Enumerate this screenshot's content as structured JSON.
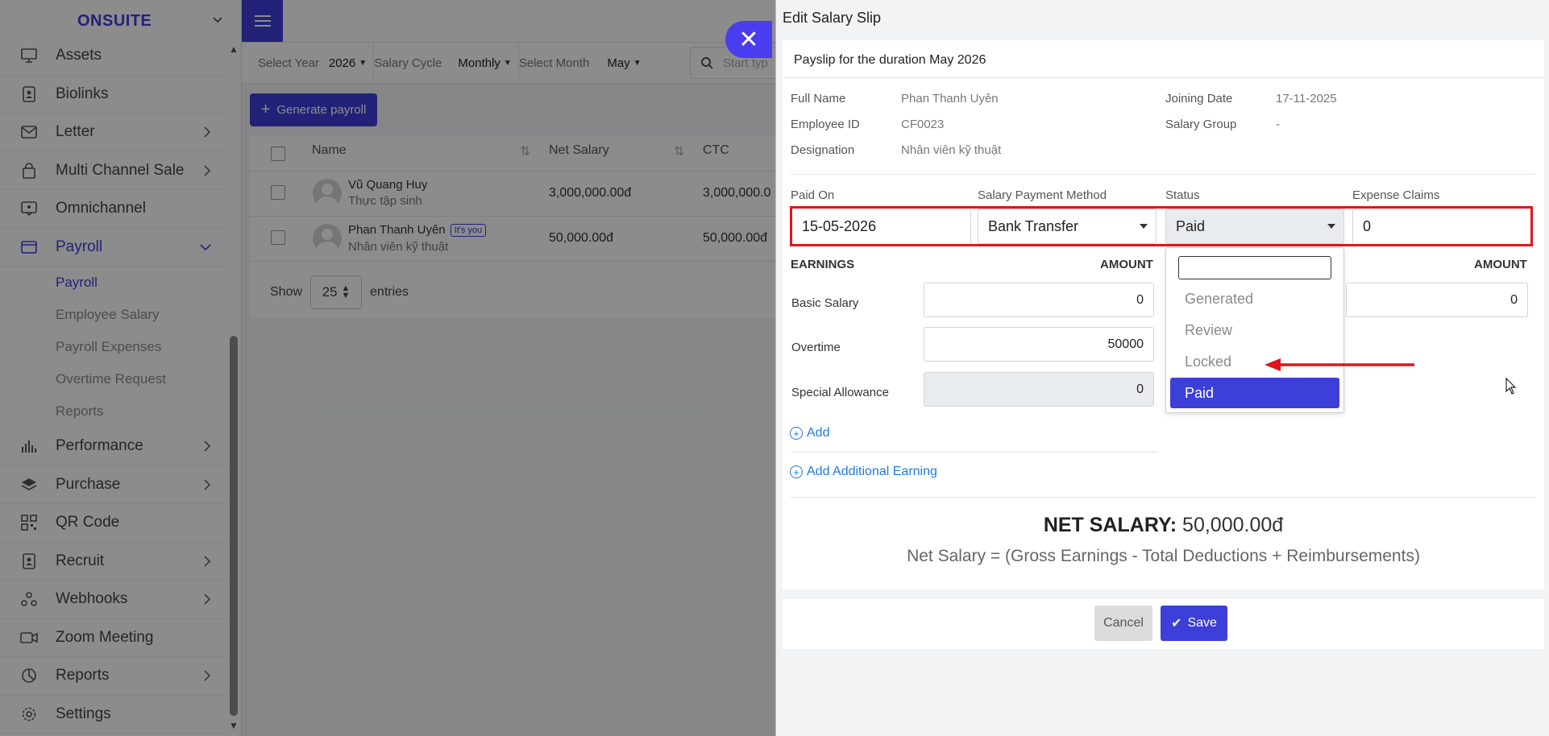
{
  "sidebar": {
    "brand": "ONSUITE",
    "items": [
      {
        "label": "Assets",
        "icon": "monitor-icon",
        "has_arrow": false
      },
      {
        "label": "Biolinks",
        "icon": "id-badge-icon",
        "has_arrow": false
      },
      {
        "label": "Letter",
        "icon": "mail-icon",
        "has_arrow": true
      },
      {
        "label": "Multi Channel Sale",
        "icon": "shopping-bag-icon",
        "has_arrow": true
      },
      {
        "label": "Omnichannel",
        "icon": "chat-icon",
        "has_arrow": false
      },
      {
        "label": "Payroll",
        "icon": "wallet-icon",
        "has_arrow": true,
        "expanded": true
      }
    ],
    "payroll_sub": [
      "Payroll",
      "Employee Salary",
      "Payroll Expenses",
      "Overtime Request",
      "Reports"
    ],
    "items_after": [
      {
        "label": "Performance",
        "icon": "bar-chart-icon",
        "has_arrow": true
      },
      {
        "label": "Purchase",
        "icon": "layers-icon",
        "has_arrow": true
      },
      {
        "label": "QR Code",
        "icon": "qr-code-icon",
        "has_arrow": false
      },
      {
        "label": "Recruit",
        "icon": "id-badge-icon",
        "has_arrow": true
      },
      {
        "label": "Webhooks",
        "icon": "webhook-icon",
        "has_arrow": true
      },
      {
        "label": "Zoom Meeting",
        "icon": "video-icon",
        "has_arrow": false
      },
      {
        "label": "Reports",
        "icon": "pie-chart-icon",
        "has_arrow": true
      },
      {
        "label": "Settings",
        "icon": "gear-icon",
        "has_arrow": false
      }
    ]
  },
  "filters": {
    "year_label": "Select Year",
    "year_value": "2026",
    "cycle_label": "Salary Cycle",
    "cycle_value": "Monthly",
    "month_label": "Select Month",
    "month_value": "May",
    "search_placeholder": "Start typ"
  },
  "generate_button": "Generate payroll",
  "table": {
    "headers": {
      "name": "Name",
      "net_salary": "Net Salary",
      "ctc": "CTC"
    },
    "rows": [
      {
        "name": "Vũ Quang Huy",
        "role": "Thực tập sinh",
        "net": "3,000,000.00đ",
        "ctc": "3,000,000.0",
        "badge": ""
      },
      {
        "name": "Phan Thanh Uyên",
        "role": "Nhân viên kỹ thuật",
        "net": "50,000.00đ",
        "ctc": "50,000.00đ",
        "badge": "It's you"
      }
    ],
    "show_label": "Show",
    "show_value": "25",
    "entries_label": "entries"
  },
  "drawer": {
    "title": "Edit Salary Slip",
    "payslip_header": "Payslip for the duration May 2026",
    "info": {
      "full_name_label": "Full Name",
      "full_name": "Phan Thanh Uyên",
      "employee_id_label": "Employee ID",
      "employee_id": "CF0023",
      "designation_label": "Designation",
      "designation": "Nhân viên kỹ thuật",
      "joining_date_label": "Joining Date",
      "joining_date": "17-11-2025",
      "salary_group_label": "Salary Group",
      "salary_group": "-"
    },
    "fields": {
      "paid_on_label": "Paid On",
      "paid_on": "15-05-2026",
      "method_label": "Salary Payment Method",
      "method": "Bank Transfer",
      "status_label": "Status",
      "status": "Paid",
      "expense_label": "Expense Claims",
      "expense": "0"
    },
    "earnings": {
      "header": "EARNINGS",
      "amount_header": "AMOUNT",
      "rows": [
        {
          "label": "Basic Salary",
          "value": "0"
        },
        {
          "label": "Overtime",
          "value": "50000"
        },
        {
          "label": "Special Allowance",
          "value": "0"
        }
      ],
      "add_label": "Add",
      "add_additional_label": "Add Additional Earning"
    },
    "deductions": {
      "amount_header": "AMOUNT",
      "first_value": "0"
    },
    "net": {
      "label": "NET SALARY:",
      "value": "50,000.00đ",
      "formula": "Net Salary = (Gross Earnings - Total Deductions + Reimbursements)"
    },
    "cancel": "Cancel",
    "save": "Save"
  },
  "status_dropdown": {
    "options": [
      "Generated",
      "Review",
      "Locked",
      "Paid"
    ],
    "selected": "Paid"
  },
  "colors": {
    "primary": "#3d3fd9",
    "highlight": "#e0151b",
    "link": "#1f7ae0"
  }
}
